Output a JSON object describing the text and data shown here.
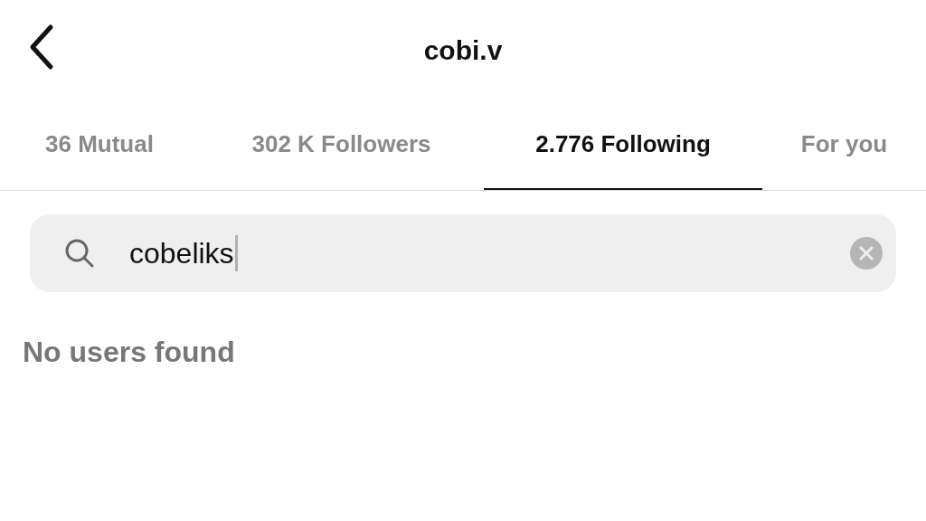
{
  "header": {
    "title": "cobi.v"
  },
  "tabs": [
    {
      "label": "36 Mutual",
      "selected": false
    },
    {
      "label": "302 K Followers",
      "selected": false
    },
    {
      "label": "2.776 Following",
      "selected": true
    },
    {
      "label": "For you",
      "selected": false
    }
  ],
  "search": {
    "value": "cobeliks"
  },
  "empty_message": "No users found"
}
